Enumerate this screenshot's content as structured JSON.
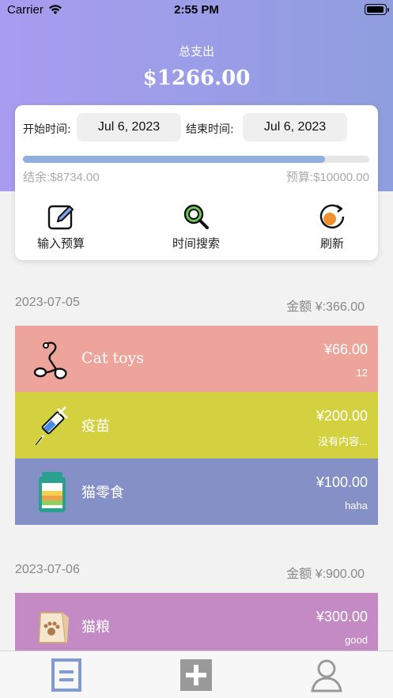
{
  "status_bar": {
    "carrier": "Carrier",
    "time": "2:55 PM"
  },
  "header": {
    "total_label": "总支出",
    "total_amount": "$1266.00"
  },
  "filter": {
    "start_label": "开始时间:",
    "start_date": "Jul 6, 2023",
    "end_label": "结束时间:",
    "end_date": "Jul 6, 2023"
  },
  "budget": {
    "balance": "结余:$8734.00",
    "budget": "预算:$10000.00",
    "progress_fraction": 0.873
  },
  "actions": [
    {
      "label": "输入预算",
      "icon": "edit-icon"
    },
    {
      "label": "时间搜索",
      "icon": "search-icon"
    },
    {
      "label": "刷新",
      "icon": "refresh-icon"
    }
  ],
  "groups": [
    {
      "date": "2023-07-05",
      "total": "金额 ¥:366.00",
      "items": [
        {
          "name": "Cat toys",
          "amount": "¥66.00",
          "note": "12",
          "color": "#eda59b",
          "icon": "cat-toy-icon"
        },
        {
          "name": "疫苗",
          "amount": "¥200.00",
          "note": "没有内容...",
          "color": "#d4d141",
          "icon": "syringe-icon"
        },
        {
          "name": "猫零食",
          "amount": "¥100.00",
          "note": "haha",
          "color": "#8590c7",
          "icon": "snack-jar-icon"
        }
      ]
    },
    {
      "date": "2023-07-06",
      "total": "金额 ¥:900.00",
      "items": [
        {
          "name": "猫粮",
          "amount": "¥300.00",
          "note": "good",
          "color": "#c38ac3",
          "icon": "cat-food-bag-icon"
        }
      ]
    }
  ],
  "tabbar": [
    {
      "icon": "list-icon",
      "active": true
    },
    {
      "icon": "add-icon",
      "active": false
    },
    {
      "icon": "profile-icon",
      "active": false
    }
  ],
  "colors": {
    "header_start": "#a89cf0",
    "header_end": "#8f9edf",
    "progress": "#8fb0de",
    "tab_active": "#7f9bd6"
  }
}
